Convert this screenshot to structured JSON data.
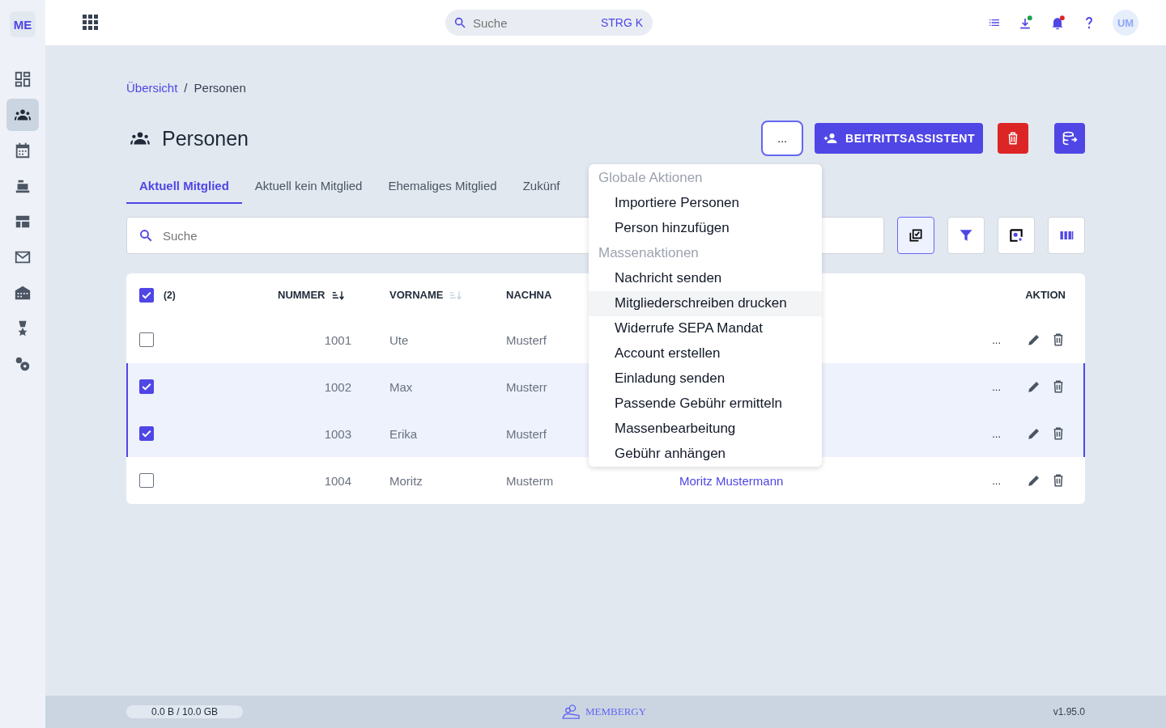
{
  "sidebar": {
    "logo": "ME",
    "items": [
      {
        "selected": false
      },
      {
        "selected": true
      },
      {
        "selected": false
      },
      {
        "selected": false
      },
      {
        "selected": false
      },
      {
        "selected": false
      },
      {
        "selected": false
      },
      {
        "selected": false
      },
      {
        "selected": false
      }
    ]
  },
  "topbar": {
    "search": {
      "placeholder": "Suche",
      "shortcut": "STRG K"
    },
    "avatar": "UM"
  },
  "breadcrumb": [
    {
      "label": "Übersicht",
      "link": true
    },
    {
      "label": "Personen",
      "link": false
    }
  ],
  "breadcrumb_separator": "/",
  "page": {
    "title": "Personen",
    "more_button": "...",
    "primary_button": "BEITRITTSASSISTENT"
  },
  "tabs": [
    {
      "label": "Aktuell Mitglied",
      "selected": true
    },
    {
      "label": "Aktuell kein Mitglied",
      "selected": false
    },
    {
      "label": "Ehemaliges Mitglied",
      "selected": false
    },
    {
      "label": "Zukünf",
      "selected": false
    }
  ],
  "search": {
    "placeholder": "Suche"
  },
  "toolbar": [
    {
      "selected": true
    },
    {
      "selected": false
    },
    {
      "selected": false
    },
    {
      "selected": false
    }
  ],
  "table": {
    "header_checked": true,
    "selected_count": "(2)",
    "columns": [
      {
        "label": "NUMMER",
        "kind": "sortable",
        "sorted": true
      },
      {
        "label": "VORNAME",
        "kind": "sortable",
        "sorted": false
      },
      {
        "label": "NACHNA",
        "kind": "plain"
      },
      {
        "label": "AKTION",
        "kind": "plain"
      }
    ],
    "rows": [
      {
        "number": "1001",
        "first_name": "Ute",
        "last_name": "Musterf",
        "selected": false,
        "more": "..."
      },
      {
        "number": "1002",
        "first_name": "Max",
        "last_name": "Musterr",
        "selected": true,
        "more": "..."
      },
      {
        "number": "1003",
        "first_name": "Erika",
        "last_name": "Musterf",
        "selected": true,
        "more": "..."
      },
      {
        "number": "1004",
        "first_name": "Moritz",
        "last_name": "Musterm",
        "link": "Moritz Mustermann",
        "selected": false,
        "more": "..."
      }
    ]
  },
  "menu": [
    {
      "kind": "heading",
      "label": "Globale Aktionen"
    },
    {
      "kind": "item",
      "label": "Importiere Personen",
      "hovered": false
    },
    {
      "kind": "item",
      "label": "Person hinzufügen",
      "hovered": false
    },
    {
      "kind": "heading",
      "label": "Massenaktionen"
    },
    {
      "kind": "item",
      "label": "Nachricht senden",
      "hovered": false
    },
    {
      "kind": "item",
      "label": "Mitgliederschreiben drucken",
      "hovered": true
    },
    {
      "kind": "item",
      "label": "Widerrufe SEPA Mandat",
      "hovered": false
    },
    {
      "kind": "item",
      "label": "Account erstellen",
      "hovered": false
    },
    {
      "kind": "item",
      "label": "Einladung senden",
      "hovered": false
    },
    {
      "kind": "item",
      "label": "Passende Gebühr ermitteln",
      "hovered": false
    },
    {
      "kind": "item",
      "label": "Massenbearbeitung",
      "hovered": false
    },
    {
      "kind": "item",
      "label": "Gebühr anhängen",
      "hovered": false
    }
  ],
  "footer": {
    "storage": "0.0 B / 10.0 GB",
    "level": 0,
    "brand": "MEMBERGY",
    "version": "v1.95.0"
  }
}
